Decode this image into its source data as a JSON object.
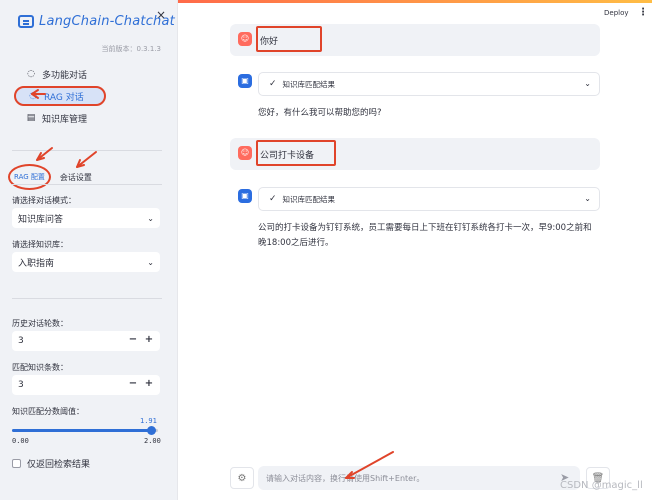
{
  "sidebar": {
    "close": "×",
    "logo": "LangChain-Chatchat",
    "version": "当前版本：0.3.1.3",
    "nav": [
      {
        "icon": "chat-bubble-icon",
        "glyph": "◌",
        "label": "多功能对话"
      },
      {
        "icon": "chat-bubble-icon",
        "glyph": "◌",
        "label": "RAG 对话"
      },
      {
        "icon": "database-icon",
        "glyph": "▤",
        "label": "知识库管理"
      }
    ],
    "tabs": [
      "RAG 配置",
      "会话设置"
    ],
    "mode_label": "请选择对话模式：",
    "mode_value": "知识库问答",
    "kb_label": "请选择知识库：",
    "kb_value": "入职指南",
    "history_label": "历史对话轮数：",
    "history_value": "3",
    "match_label": "匹配知识条数：",
    "match_value": "3",
    "threshold_label": "知识匹配分数阈值：",
    "threshold_value": "1.91",
    "threshold_min": "0.00",
    "threshold_max": "2.00",
    "threshold_fraction": 0.955,
    "checkbox_label": "仅返回检索结果",
    "minus": "−",
    "plus": "+"
  },
  "header": {
    "deploy": "Deploy",
    "menu": "⋮"
  },
  "chat": {
    "messages": [
      {
        "role": "user",
        "text": "你好"
      },
      {
        "role": "assistant",
        "expander": "知识库匹配结果",
        "text": "您好，有什么我可以帮助您的吗?"
      },
      {
        "role": "user",
        "text": "公司打卡设备"
      },
      {
        "role": "assistant",
        "expander": "知识库匹配结果",
        "text": "公司的打卡设备为钉钉系统，员工需要每日上下班在钉钉系统各打卡一次，早9:00之前和晚18:00之后进行。"
      }
    ],
    "input_placeholder": "请输入对话内容，换行请使用Shift+Enter。"
  },
  "watermark": "CSDN @magic_ll",
  "colors": {
    "accent": "#2f6fd6",
    "annotation": "#e0442a"
  }
}
